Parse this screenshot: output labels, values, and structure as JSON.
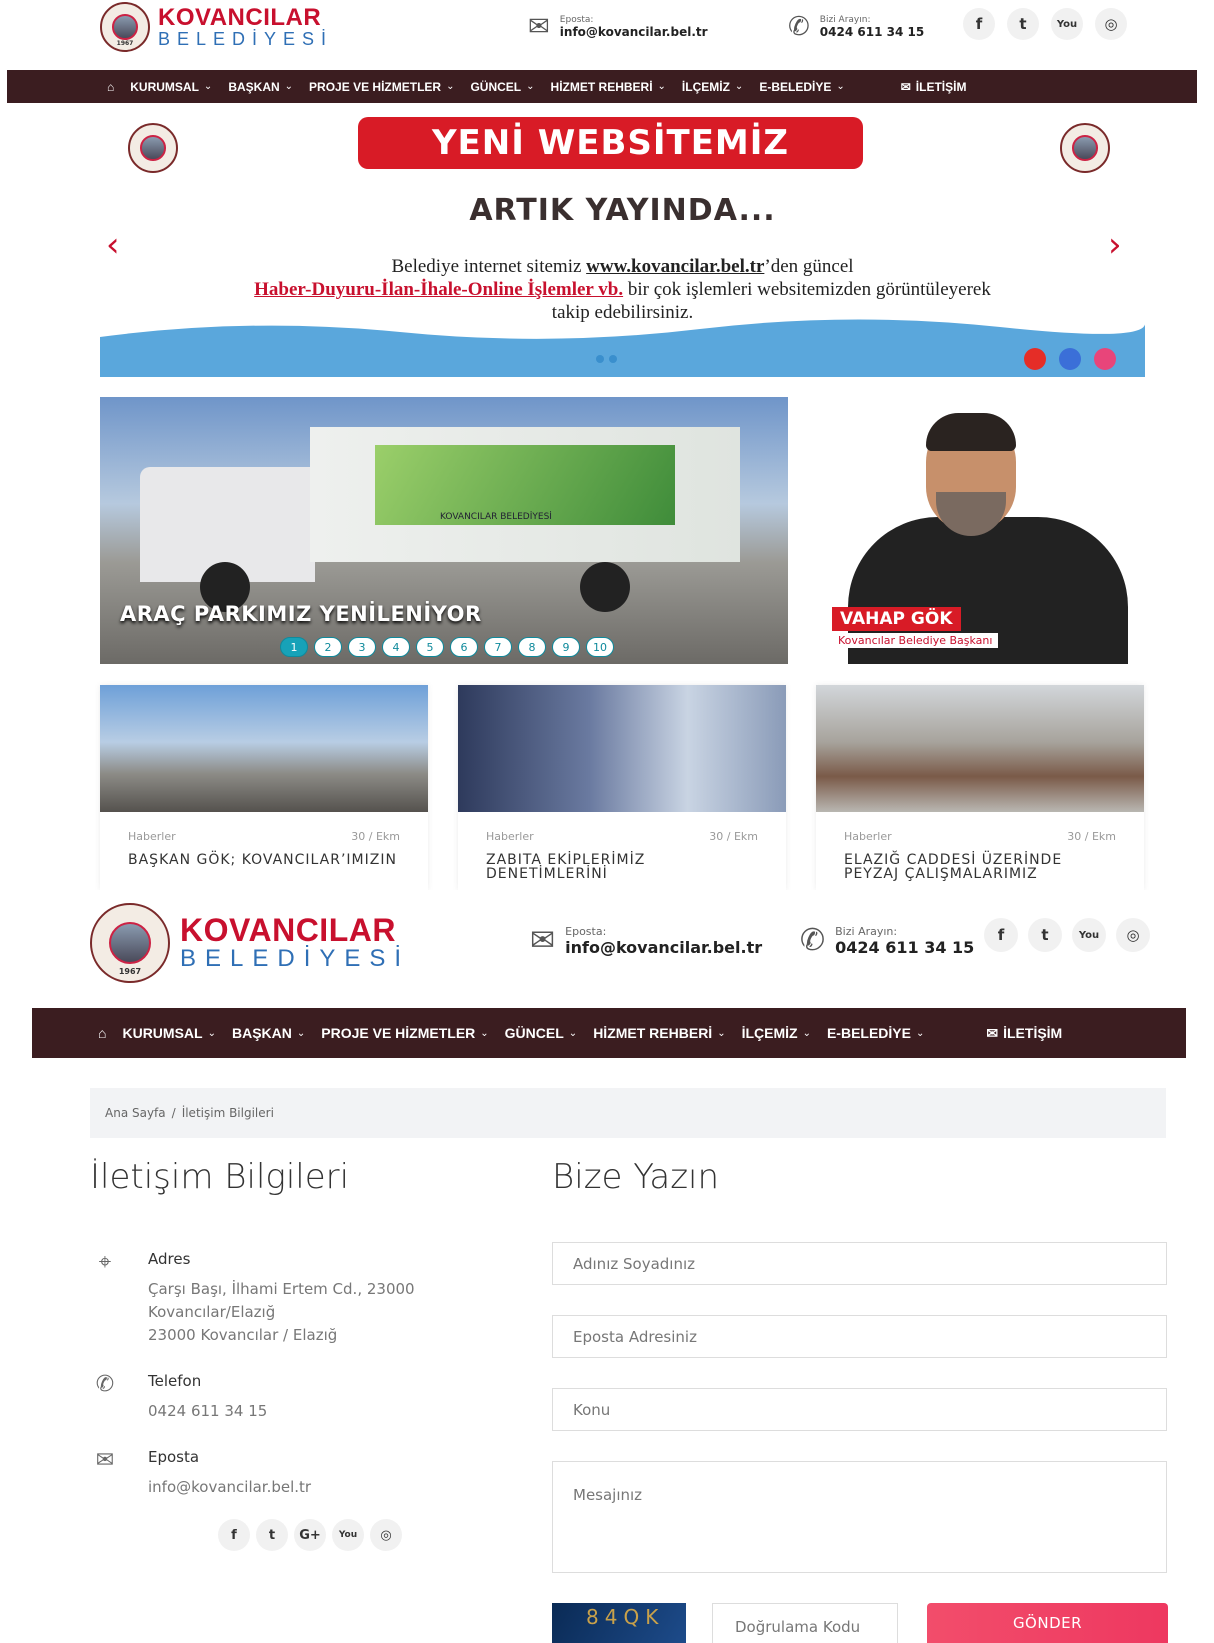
{
  "brand": {
    "name": "KOVANCILAR",
    "sub": "BELEDİYESİ",
    "year": "1967"
  },
  "contact": {
    "email_label": "Eposta:",
    "email": "info@kovancilar.bel.tr",
    "phone_label": "Bizi Arayın:",
    "phone": "0424 611 34 15"
  },
  "social": {
    "facebook": "f",
    "twitter": "t",
    "youtube": "You",
    "instagram": "◎",
    "google": "G+"
  },
  "nav": {
    "home_icon": "home-icon",
    "items": [
      "KURUMSAL",
      "BAŞKAN",
      "PROJE VE HİZMETLER",
      "GÜNCEL",
      "HİZMET REHBERİ",
      "İLÇEMİZ",
      "E-BELEDİYE"
    ],
    "contact": "İLETİŞİM"
  },
  "banner": {
    "headline": "YENİ WEBSİTEMİZ",
    "sub": "ARTIK YAYINDA...",
    "line1_a": "Belediye internet sitemiz ",
    "line1_link": "www.kovancilar.bel.tr",
    "line1_b": "’den güncel",
    "line2_link": "Haber-Duyuru-İlan-İhale-Online İşlemler vb.",
    "line2_b": " bir çok işlemleri websitemizden görüntüleyerek",
    "line3": "takip edebilirsiniz."
  },
  "slider": {
    "caption": "ARAÇ PARKIMIZ YENİLENİYOR",
    "truck_text": "KOVANCILAR BELEDİYESİ",
    "pages": [
      "1",
      "2",
      "3",
      "4",
      "5",
      "6",
      "7",
      "8",
      "9",
      "10"
    ],
    "active": 1
  },
  "mayor": {
    "name": "VAHAP GÖK",
    "title": "Kovancılar Belediye Başkanı"
  },
  "news": [
    {
      "cat": "Haberler",
      "date": "30 / Ekm",
      "title": "BAŞKAN GÖK; KOVANCILAR’IMIZIN"
    },
    {
      "cat": "Haberler",
      "date": "30 / Ekm",
      "title": "ZABITA EKİPLERİMİZ DENETİMLERİNİ"
    },
    {
      "cat": "Haberler",
      "date": "30 / Ekm",
      "title": "ELAZIĞ CADDESİ ÜZERİNDE PEYZAJ ÇALIŞMALARIMIZ"
    }
  ],
  "breadcrumb": {
    "home": "Ana Sayfa",
    "sep": "/",
    "current": "İletişim Bilgileri"
  },
  "info": {
    "heading": "İletişim Bilgileri",
    "address_label": "Adres",
    "address_l1": "Çarşı Başı, İlhami Ertem Cd., 23000",
    "address_l2": "Kovancılar/Elazığ",
    "address_l3": "23000 Kovancılar / Elazığ",
    "phone_label": "Telefon",
    "phone": "0424 611 34 15",
    "email_label": "Eposta",
    "email": "info@kovancilar.bel.tr"
  },
  "form": {
    "heading": "Bize Yazın",
    "name": "Adınız Soyadınız",
    "email": "Eposta Adresiniz",
    "subject": "Konu",
    "message": "Mesajınız",
    "captcha": "84QK",
    "verify": "Doğrulama Kodu",
    "send": "GÖNDER"
  },
  "colors": {
    "nav_bg": "#3b1d20",
    "brand_red": "#c8102e",
    "brand_blue": "#2f6fb5",
    "send_btn": "#ee3860"
  }
}
